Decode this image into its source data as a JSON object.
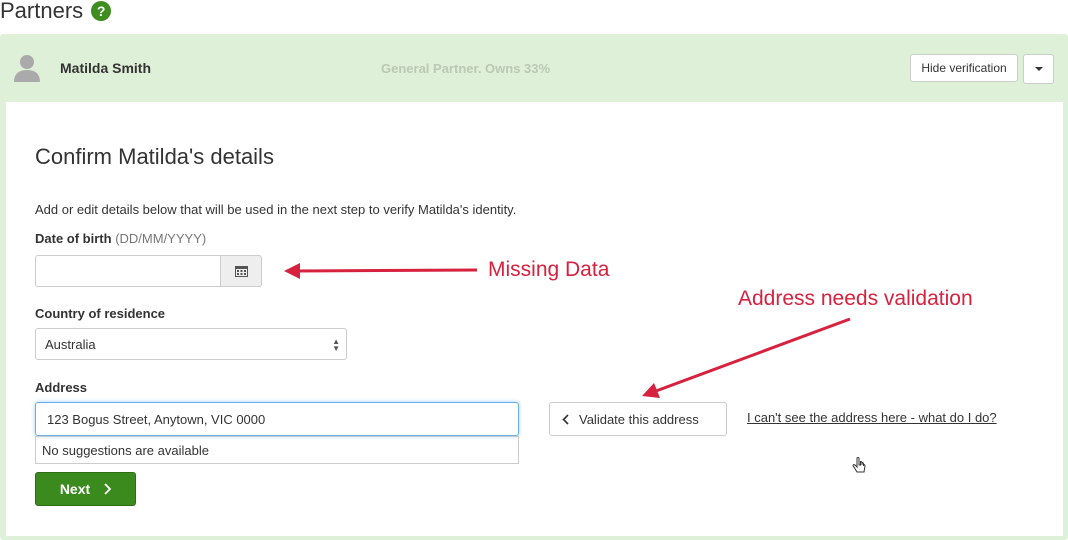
{
  "page": {
    "title": "Partners",
    "help_icon": "?"
  },
  "partner": {
    "name": "Matilda Smith",
    "role": "General Partner. Owns 33%",
    "hide_verification_label": "Hide verification"
  },
  "form": {
    "heading": "Confirm Matilda's details",
    "intro": "Add or edit details below that will be used in the next step to verify Matilda's identity.",
    "dob_label": "Date of birth",
    "dob_hint": "(DD/MM/YYYY)",
    "dob_value": "",
    "country_label": "Country of residence",
    "country_value": "Australia",
    "address_label": "Address",
    "address_value": "123 Bogus Street, Anytown, VIC 0000",
    "suggestion_text": "No suggestions are available",
    "validate_label": "Validate this address",
    "help_link": "I can't see the address here - what do I do?",
    "next_label": "Next"
  },
  "annotations": {
    "missing_data": "Missing Data",
    "address_validation": "Address needs validation"
  },
  "colors": {
    "accent_green": "#3b8a1e",
    "panel_green": "#dff0d8",
    "annotation_red": "#d6213f"
  }
}
